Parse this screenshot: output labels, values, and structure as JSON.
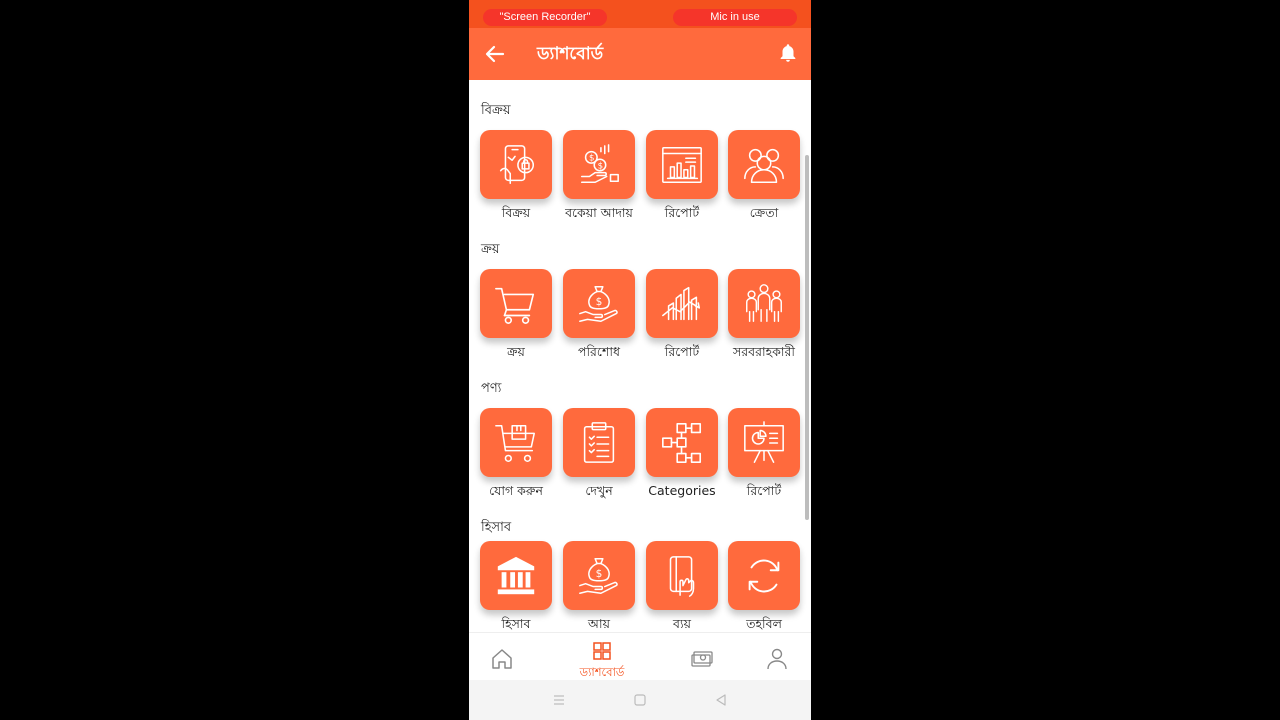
{
  "status_bar": {
    "recorder_label": "\"Screen Recorder\"",
    "mic_label": "Mic in use"
  },
  "app_bar": {
    "title": "ড্যাশবোর্ড",
    "back_icon": "arrow-left-icon",
    "bell_icon": "bell-icon"
  },
  "colors": {
    "primary": "#ff6a3d",
    "status": "#f4511e",
    "pill": "#f5352a"
  },
  "sections": [
    {
      "title": "বিক্রয়",
      "items": [
        {
          "label": "বিক্রয়",
          "icon": "mobile-shopping-icon"
        },
        {
          "label": "বকেয়া আদায়",
          "icon": "coins-hand-icon"
        },
        {
          "label": "রিপোর্ট",
          "icon": "browser-chart-icon"
        },
        {
          "label": "ক্রেতা",
          "icon": "customers-icon"
        }
      ]
    },
    {
      "title": "ক্রয়",
      "items": [
        {
          "label": "ক্রয়",
          "icon": "cart-icon"
        },
        {
          "label": "পরিশোধ",
          "icon": "money-bag-hand-icon"
        },
        {
          "label": "রিপোর্ট",
          "icon": "growth-chart-icon"
        },
        {
          "label": "সরবরাহকারী",
          "icon": "suppliers-icon"
        }
      ]
    },
    {
      "title": "পণ্য",
      "items": [
        {
          "label": "যোগ করুন",
          "icon": "cart-box-icon"
        },
        {
          "label": "দেখুন",
          "icon": "clipboard-list-icon"
        },
        {
          "label": "Categories",
          "icon": "hierarchy-icon"
        },
        {
          "label": "রিপোর্ট",
          "icon": "presentation-board-icon"
        }
      ]
    },
    {
      "title": "হিসাব",
      "items": [
        {
          "label": "হিসাব",
          "icon": "bank-icon"
        },
        {
          "label": "আয়",
          "icon": "money-bag-hand-icon"
        },
        {
          "label": "ব্যয়",
          "icon": "card-hand-icon"
        },
        {
          "label": "তহবিল",
          "icon": "refresh-icon"
        }
      ]
    }
  ],
  "bottom_nav": {
    "home_icon": "home-icon",
    "dashboard_label": "ড্যাশবোর্ড",
    "dashboard_icon": "grid-icon",
    "money_icon": "cash-icon",
    "profile_icon": "user-icon"
  },
  "system_nav": {
    "menu_icon": "menu-icon",
    "home_icon": "square-icon",
    "back_icon": "triangle-back-icon"
  }
}
